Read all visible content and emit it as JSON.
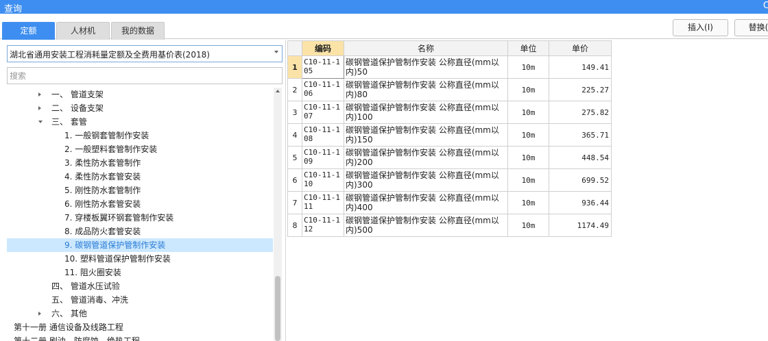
{
  "window": {
    "title": "查询",
    "close_glyph": "C"
  },
  "tabs": [
    {
      "label": "定额",
      "active": true
    },
    {
      "label": "人材机",
      "active": false
    },
    {
      "label": "我的数据",
      "active": false
    }
  ],
  "actions": {
    "insert_label": "插入(I)",
    "replace_label": "替换("
  },
  "library_select": {
    "value": "湖北省通用安装工程消耗量定额及全费用基价表(2018)"
  },
  "search": {
    "placeholder": "搜索",
    "value": ""
  },
  "tree": [
    {
      "text": "一、 管道支架",
      "level": 1,
      "toggle": "collapsed",
      "selected": false
    },
    {
      "text": "二、 设备支架",
      "level": 1,
      "toggle": "collapsed",
      "selected": false
    },
    {
      "text": "三、 套管",
      "level": 1,
      "toggle": "expanded",
      "selected": false
    },
    {
      "text": "1. 一般钢套管制作安装",
      "level": 2,
      "toggle": "none",
      "selected": false
    },
    {
      "text": "2. 一般塑料套管制作安装",
      "level": 2,
      "toggle": "none",
      "selected": false
    },
    {
      "text": "3. 柔性防水套管制作",
      "level": 2,
      "toggle": "none",
      "selected": false
    },
    {
      "text": "4. 柔性防水套管安装",
      "level": 2,
      "toggle": "none",
      "selected": false
    },
    {
      "text": "5. 刚性防水套管制作",
      "level": 2,
      "toggle": "none",
      "selected": false
    },
    {
      "text": "6. 刚性防水套管安装",
      "level": 2,
      "toggle": "none",
      "selected": false
    },
    {
      "text": "7. 穿楼板翼环钢套管制作安装",
      "level": 2,
      "toggle": "none",
      "selected": false
    },
    {
      "text": "8. 成品防火套管安装",
      "level": 2,
      "toggle": "none",
      "selected": false
    },
    {
      "text": "9. 碳钢管道保护管制作安装",
      "level": 2,
      "toggle": "none",
      "selected": true
    },
    {
      "text": "10. 塑料管道保护管制作安装",
      "level": 2,
      "toggle": "none",
      "selected": false
    },
    {
      "text": "11. 阻火圈安装",
      "level": 2,
      "toggle": "none",
      "selected": false
    },
    {
      "text": "四、 管道水压试验",
      "level": 1,
      "toggle": "none",
      "selected": false
    },
    {
      "text": "五、 管道消毒、冲洗",
      "level": 1,
      "toggle": "none",
      "selected": false
    },
    {
      "text": "六、 其他",
      "level": 1,
      "toggle": "collapsed",
      "selected": false
    },
    {
      "text": "第十一册 通信设备及线路工程",
      "level": 0,
      "toggle": "collapsed",
      "selected": false
    },
    {
      "text": "第十二册 刷油、防腐蚀、绝热工程",
      "level": 0,
      "toggle": "collapsed",
      "selected": false
    }
  ],
  "table": {
    "headers": {
      "row_no": "",
      "code": "编码",
      "name": "名称",
      "unit": "单位",
      "price": "单价"
    },
    "rows": [
      {
        "no": "1",
        "code": "C10-11-105",
        "name": "碳钢管道保护管制作安装 公称直径(mm以内)50",
        "unit": "10m",
        "price": "149.41"
      },
      {
        "no": "2",
        "code": "C10-11-106",
        "name": "碳钢管道保护管制作安装 公称直径(mm以内)80",
        "unit": "10m",
        "price": "225.27"
      },
      {
        "no": "3",
        "code": "C10-11-107",
        "name": "碳钢管道保护管制作安装 公称直径(mm以内)100",
        "unit": "10m",
        "price": "275.82"
      },
      {
        "no": "4",
        "code": "C10-11-108",
        "name": "碳钢管道保护管制作安装 公称直径(mm以内)150",
        "unit": "10m",
        "price": "365.71"
      },
      {
        "no": "5",
        "code": "C10-11-109",
        "name": "碳钢管道保护管制作安装 公称直径(mm以内)200",
        "unit": "10m",
        "price": "448.54"
      },
      {
        "no": "6",
        "code": "C10-11-110",
        "name": "碳钢管道保护管制作安装 公称直径(mm以内)300",
        "unit": "10m",
        "price": "699.52"
      },
      {
        "no": "7",
        "code": "C10-11-111",
        "name": "碳钢管道保护管制作安装 公称直径(mm以内)400",
        "unit": "10m",
        "price": "936.44"
      },
      {
        "no": "8",
        "code": "C10-11-112",
        "name": "碳钢管道保护管制作安装 公称直径(mm以内)500",
        "unit": "10m",
        "price": "1174.49"
      }
    ]
  },
  "colors": {
    "accent": "#3d8ef0",
    "selected_row_bg": "#cce8ff",
    "selected_row_text": "#2a7bd4",
    "header_highlight": "#fbe3a8"
  }
}
